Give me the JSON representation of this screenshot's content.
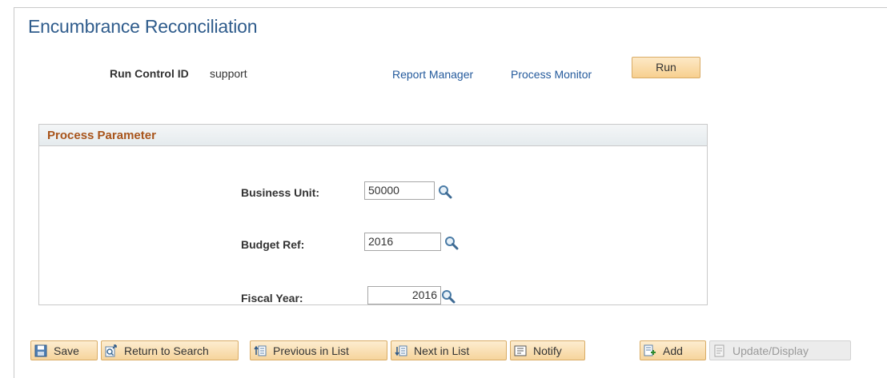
{
  "page": {
    "title": "Encumbrance Reconciliation"
  },
  "run_control": {
    "label": "Run Control ID",
    "value": "support",
    "report_manager_link": "Report Manager",
    "process_monitor_link": "Process Monitor",
    "run_button": "Run"
  },
  "process_parameter": {
    "header": "Process Parameter",
    "business_unit": {
      "label": "Business Unit:",
      "value": "50000",
      "icon": "magnifier-lookup-icon"
    },
    "budget_ref": {
      "label": "Budget Ref:",
      "value": "2016",
      "icon": "magnifier-lookup-icon"
    },
    "fiscal_year": {
      "label": "Fiscal Year:",
      "value": "2016",
      "icon": "magnifier-lookup-icon"
    }
  },
  "toolbar": {
    "save": {
      "label": "Save",
      "icon": "save-disk-icon"
    },
    "return_to_search": {
      "label": "Return to Search",
      "icon": "return-to-search-icon"
    },
    "previous_in_list": {
      "label": "Previous in List",
      "icon": "previous-in-list-icon"
    },
    "next_in_list": {
      "label": "Next in List",
      "icon": "next-in-list-icon"
    },
    "notify": {
      "label": "Notify",
      "icon": "notify-icon"
    },
    "add": {
      "label": "Add",
      "icon": "add-document-icon"
    },
    "update_display": {
      "label": "Update/Display",
      "icon": "update-display-icon",
      "disabled": true
    }
  },
  "colors": {
    "title": "#2f5c8c",
    "link": "#245a9c",
    "group_header_text": "#a8541b",
    "button_orange": "#f7cf8f"
  }
}
